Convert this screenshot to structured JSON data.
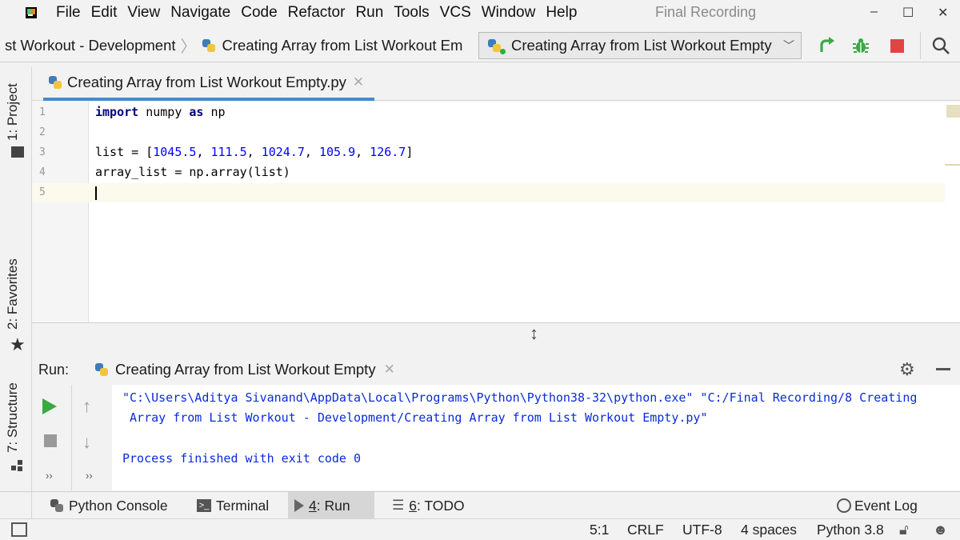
{
  "menu": {
    "items": [
      {
        "label": "File"
      },
      {
        "label": "Edit"
      },
      {
        "label": "View"
      },
      {
        "label": "Navigate"
      },
      {
        "label": "Code"
      },
      {
        "label": "Refactor"
      },
      {
        "label": "Run"
      },
      {
        "label": "Tools"
      },
      {
        "label": "VCS"
      },
      {
        "label": "Window"
      },
      {
        "label": "Help"
      }
    ],
    "window_title": "Final Recording",
    "minimize": "–",
    "maximize": "☐",
    "close": "✕"
  },
  "navbar": {
    "crumb1": "st Workout - Development",
    "crumb2": "Creating Array from List Workout Em",
    "run_config": "Creating Array from List Workout Empty"
  },
  "left_strip": {
    "project": "1: Project",
    "favorites": "2: Favorites",
    "structure": "7: Structure"
  },
  "editor": {
    "tab_label": "Creating Array from List Workout Empty.py",
    "line_numbers": [
      "1",
      "2",
      "3",
      "4",
      "5"
    ],
    "code": {
      "l1_kw1": "import",
      "l1_mid": " numpy ",
      "l1_kw2": "as",
      "l1_end": " np",
      "l3_a": "list = [",
      "l3_n1": "1045.5",
      "l3_n2": "111.5",
      "l3_n3": "1024.7",
      "l3_n4": "105.9",
      "l3_n5": "126.7",
      "l3_sep": ", ",
      "l3_end": "]",
      "l4": "array_list = np.array(list)"
    }
  },
  "run_panel": {
    "label": "Run:",
    "tab_label": "Creating Array from List Workout Empty",
    "console_lines": [
      "\"C:\\Users\\Aditya Sivanand\\AppData\\Local\\Programs\\Python\\Python38-32\\python.exe\" \"C:/Final Recording/8 Creating",
      " Array from List Workout - Development/Creating Array from List Workout Empty.py\"",
      "Process finished with exit code 0"
    ]
  },
  "bottom_tabs": {
    "python_console": "Python Console",
    "terminal": "Terminal",
    "run_num": "4",
    "run_text": ": Run",
    "todo_num": "6",
    "todo_text": ": TODO",
    "event_log": "Event Log"
  },
  "status": {
    "position": "5:1",
    "line_sep": "CRLF",
    "encoding": "UTF-8",
    "indent": "4 spaces",
    "interpreter": "Python 3.8"
  },
  "colors": {
    "accent_tab": "#4a88c7",
    "run_green": "#3aa845",
    "stop_red": "#e24444",
    "console_blue": "#0a2bd9"
  }
}
